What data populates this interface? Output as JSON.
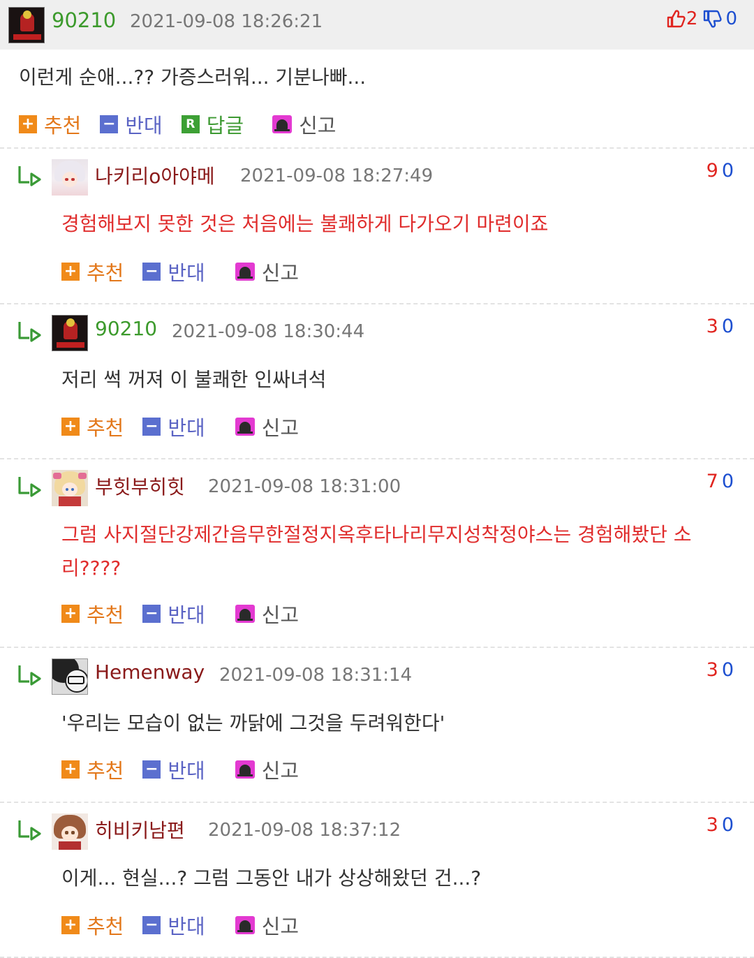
{
  "main_comment": {
    "nickname": "90210",
    "date": "2021-09-08 18:26:21",
    "upvotes": "2",
    "downvotes": "0",
    "text": "이런게 순애...?? 가증스러워... 기분나빠...",
    "actions": {
      "recommend": "추천",
      "oppose": "반대",
      "reply": "답글",
      "report": "신고"
    },
    "action_icons": {
      "recommend": "plus-icon",
      "oppose": "minus-icon",
      "reply": "r-icon",
      "report": "siren-icon"
    }
  },
  "actions": {
    "recommend": "추천",
    "oppose": "반대",
    "report": "신고"
  },
  "colors": {
    "recommend": "#f08a19",
    "oppose": "#5b6fcf",
    "reply": "#3da035",
    "report": "#e33ad1",
    "red_text": "#e02d2d",
    "up": "#e0241f",
    "down": "#1d4fd0",
    "nick_green": "#3c9a2c",
    "nick_red": "#8a1a1a"
  },
  "replies": [
    {
      "nickname": "나키리o아야메",
      "date": "2021-09-08 18:27:49",
      "upvotes": "9",
      "downvotes": "0",
      "text": "경험해보지 못한 것은 처음에는 불쾌하게 다가오기 마련이죠",
      "highlighted": true,
      "avatar": "white-hair-girl"
    },
    {
      "nickname": "90210",
      "date": "2021-09-08 18:30:44",
      "upvotes": "3",
      "downvotes": "0",
      "text": "저리 썩 꺼져 이 불쾌한 인싸녀석",
      "highlighted": false,
      "avatar": "dark-figure"
    },
    {
      "nickname": "부힛부히힛",
      "date": "2021-09-08 18:31:00",
      "upvotes": "7",
      "downvotes": "0",
      "text": "그럼 사지절단강제간음무한절정지옥후타나리무지성착정야스는 경험해봤단 소리????",
      "highlighted": true,
      "avatar": "blonde-girl"
    },
    {
      "nickname": "Hemenway",
      "date": "2021-09-08 18:31:14",
      "upvotes": "3",
      "downvotes": "0",
      "text": "'우리는 모습이 없는 까닭에 그것을 두려워한다'",
      "highlighted": false,
      "avatar": "bw-glasses"
    },
    {
      "nickname": "히비키남편",
      "date": "2021-09-08 18:37:12",
      "upvotes": "3",
      "downvotes": "0",
      "text": "이게... 현실...? 그럼 그동안 내가 상상해왔던 건...?",
      "highlighted": false,
      "avatar": "brown-hair-girl"
    }
  ]
}
